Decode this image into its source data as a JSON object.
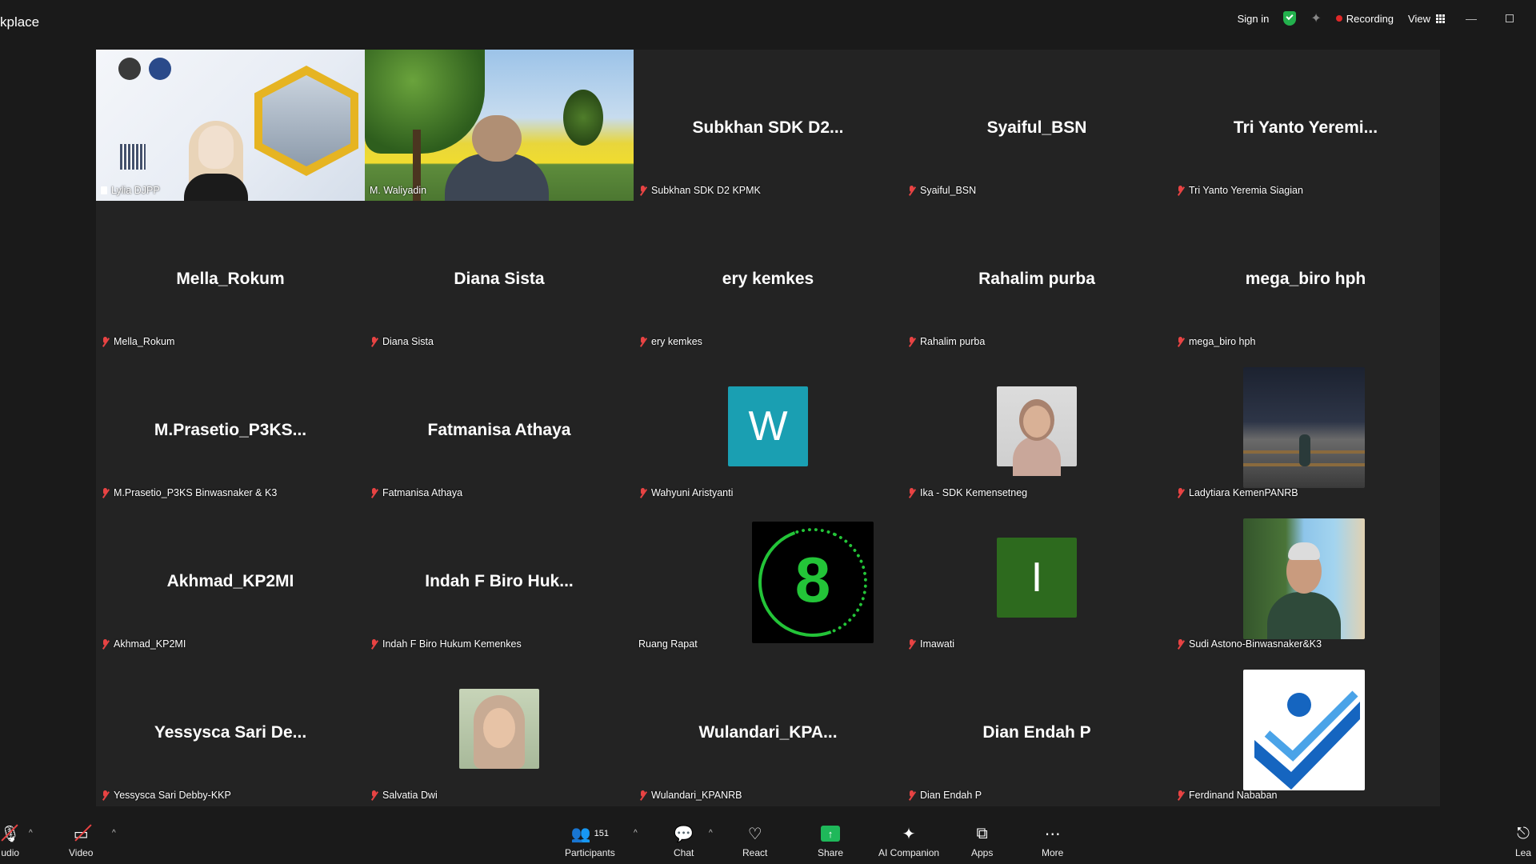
{
  "app": {
    "title": "kplace"
  },
  "topbar": {
    "sign_in": "Sign in",
    "recording": "Recording",
    "view": "View",
    "minimize": "—",
    "accent_color": "#23b14d",
    "recording_color": "#e02828"
  },
  "tiles": [
    {
      "label": "Lylia DJPP",
      "kind": "presentation"
    },
    {
      "label": "M. Waliyadin",
      "kind": "video",
      "speaking": true
    },
    {
      "big": "Subkhan SDK D2...",
      "label": "Subkhan SDK D2 KPMK"
    },
    {
      "big": "Syaiful_BSN",
      "label": "Syaiful_BSN"
    },
    {
      "big": "Tri Yanto Yeremi...",
      "label": "Tri Yanto Yeremia Siagian"
    },
    {
      "big": "Mella_Rokum",
      "label": "Mella_Rokum"
    },
    {
      "big": "Diana Sista",
      "label": "Diana Sista"
    },
    {
      "big": "ery kemkes",
      "label": "ery kemkes"
    },
    {
      "big": "Rahalim purba",
      "label": "Rahalim purba"
    },
    {
      "big": "mega_biro hph",
      "label": "mega_biro hph"
    },
    {
      "big": "M.Prasetio_P3KS...",
      "label": "M.Prasetio_P3KS Binwasnaker & K3"
    },
    {
      "big": "Fatmanisa Athaya",
      "label": "Fatmanisa Athaya"
    },
    {
      "avatar_letter": "W",
      "avatar_color": "#1a9fb2",
      "label": "Wahyuni Aristyanti"
    },
    {
      "label": "Ika - SDK Kemensetneg",
      "kind": "photo"
    },
    {
      "label": "Ladytiara KemenPANRB",
      "kind": "photo"
    },
    {
      "big": "Akhmad_KP2MI",
      "label": "Akhmad_KP2MI"
    },
    {
      "big": "Indah F Biro Huk...",
      "label": "Indah F Biro Hukum Kemenkes"
    },
    {
      "avatar_letter": "8",
      "label": "Ruang Rapat",
      "kind": "ring"
    },
    {
      "avatar_letter": "I",
      "avatar_color": "#2d6a1e",
      "label": "Imawati"
    },
    {
      "label": "Sudi Astono-Binwasnaker&K3",
      "kind": "photo"
    },
    {
      "big": "Yessysca Sari De...",
      "label": "Yessysca Sari Debby-KKP"
    },
    {
      "label": "Salvatia Dwi",
      "kind": "photo"
    },
    {
      "big": "Wulandari_KPA...",
      "label": "Wulandari_KPANRB"
    },
    {
      "big": "Dian Endah P",
      "label": "Dian Endah P"
    },
    {
      "label": "Ferdinand Nababan",
      "kind": "logo"
    }
  ],
  "toolbar": {
    "audio": "udio",
    "video": "Video",
    "participants": "Participants",
    "participants_count": "151",
    "chat": "Chat",
    "react": "React",
    "share": "Share",
    "ai_companion": "AI Companion",
    "apps": "Apps",
    "more": "More",
    "leave": "Lea",
    "share_color": "#1fb85a"
  }
}
